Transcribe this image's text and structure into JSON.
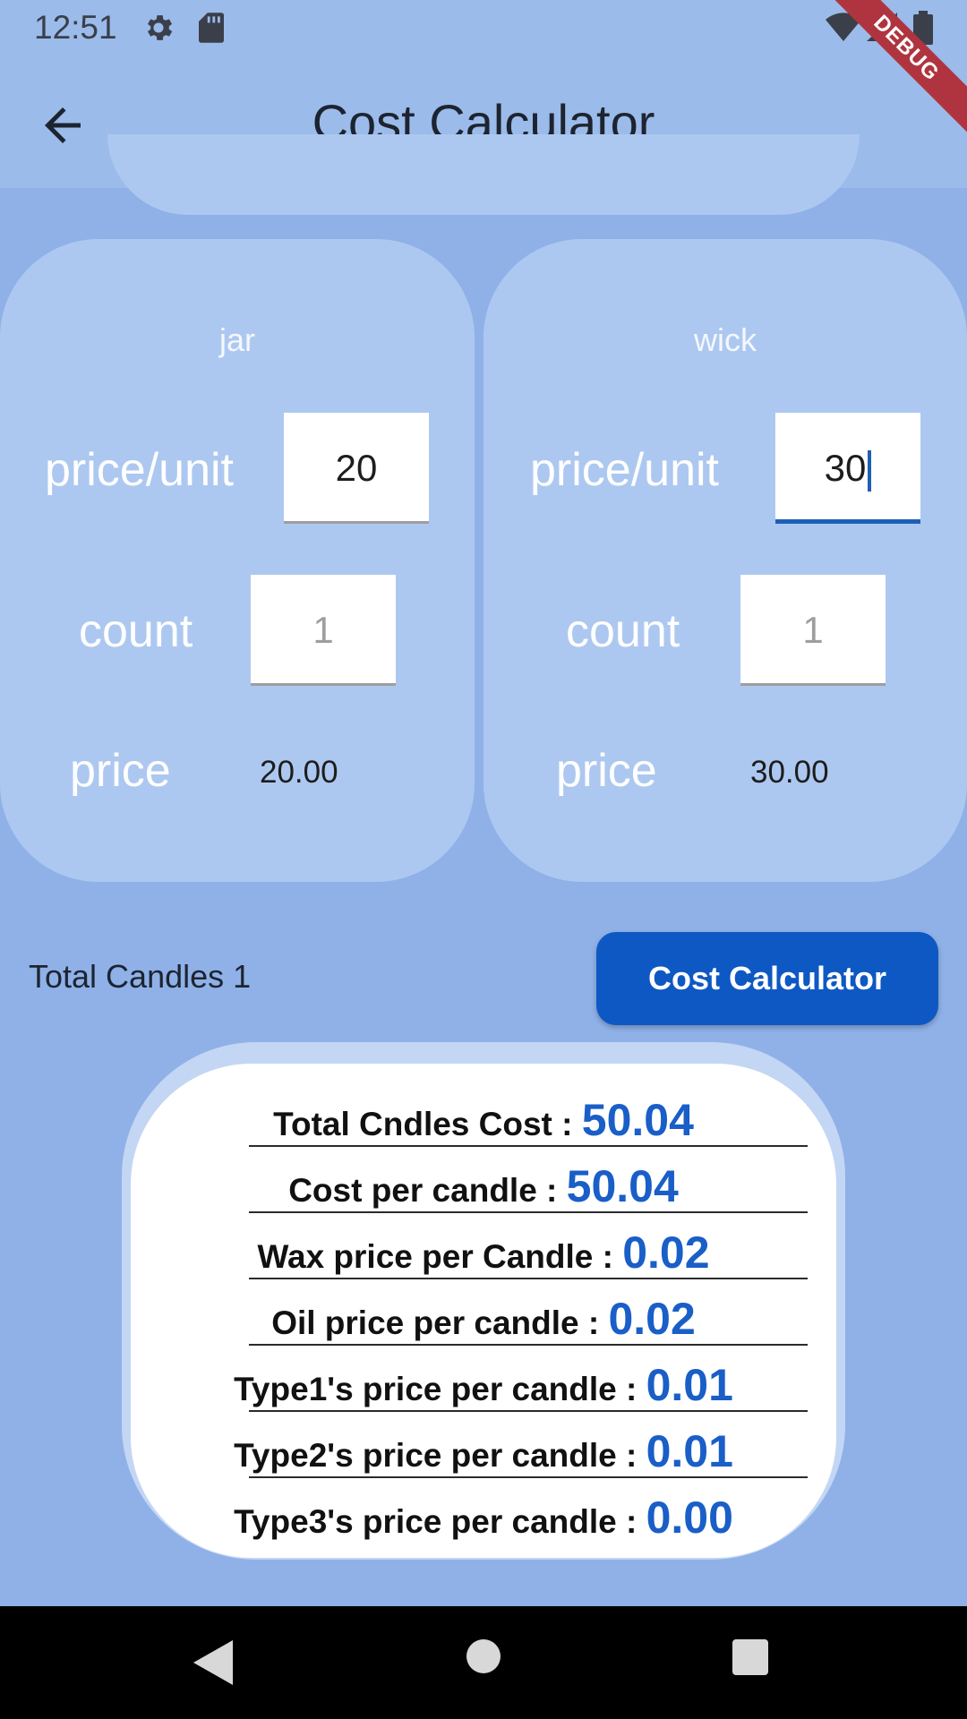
{
  "status_bar": {
    "time": "12:51",
    "icons": [
      "gear-icon",
      "sd-card-icon",
      "wifi-icon",
      "signal-icon",
      "battery-icon"
    ]
  },
  "debug_banner": "DEBUG",
  "app_bar": {
    "title": "Cost Calculator",
    "back_icon": "arrow-back-icon"
  },
  "cards": {
    "jar": {
      "title": "jar",
      "price_unit_label": "price/unit",
      "price_unit_value": "20",
      "count_label": "count",
      "count_placeholder": "1",
      "price_label": "price",
      "price_value": "20.00"
    },
    "wick": {
      "title": "wick",
      "price_unit_label": "price/unit",
      "price_unit_value": "30",
      "count_label": "count",
      "count_placeholder": "1",
      "price_label": "price",
      "price_value": "30.00"
    }
  },
  "summary": {
    "total_candles": "Total Candles 1",
    "button_label": "Cost Calculator"
  },
  "results": [
    {
      "label": "Total Cndles Cost : ",
      "value": "50.04"
    },
    {
      "label": "Cost per candle : ",
      "value": "50.04"
    },
    {
      "label": "Wax price per Candle  : ",
      "value": "0.02"
    },
    {
      "label": "Oil price per candle : ",
      "value": "0.02"
    },
    {
      "label": "Type1's price per candle : ",
      "value": "0.01"
    },
    {
      "label": "Type2's price per candle : ",
      "value": "0.01"
    },
    {
      "label": "Type3's price per candle : ",
      "value": "0.00"
    }
  ],
  "colors": {
    "background": "#8fb1e8",
    "card": "#adc8f0",
    "button": "#0e58c4",
    "result_value": "#1a5ec8",
    "debug_ribbon": "#b0343f"
  }
}
